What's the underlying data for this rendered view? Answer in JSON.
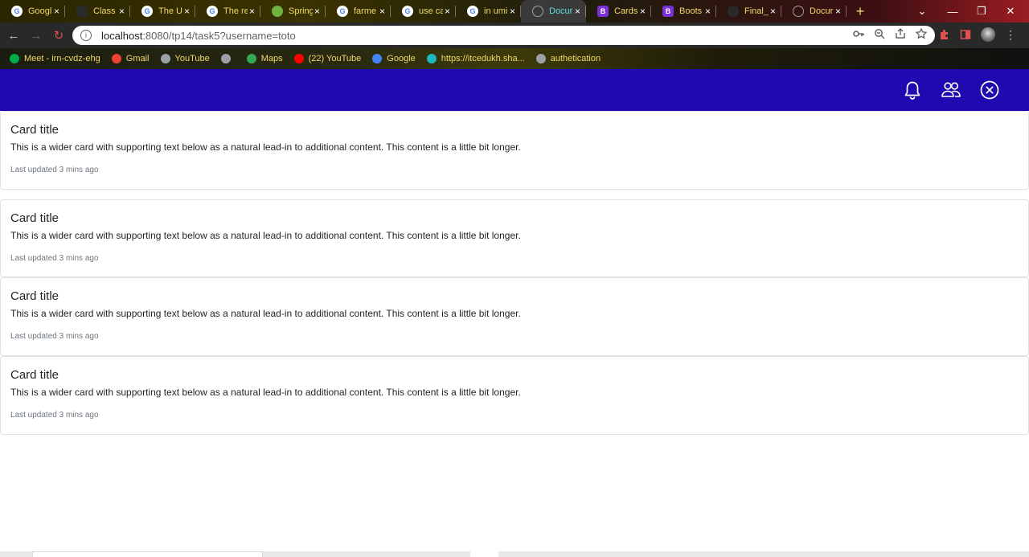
{
  "browser": {
    "tabs": [
      {
        "title": "Googl",
        "icon": "google-icon"
      },
      {
        "title": "Class",
        "icon": "classroom-icon"
      },
      {
        "title": "The U",
        "icon": "google-icon"
      },
      {
        "title": "The re",
        "icon": "google-icon"
      },
      {
        "title": "Spring",
        "icon": "spring-icon"
      },
      {
        "title": "farme",
        "icon": "google-icon"
      },
      {
        "title": "use ca",
        "icon": "google-icon"
      },
      {
        "title": "in umi",
        "icon": "google-icon"
      },
      {
        "title": "Docur",
        "icon": "globe-icon",
        "active": true
      },
      {
        "title": "Cards",
        "icon": "bootstrap-icon"
      },
      {
        "title": "Boots",
        "icon": "bootstrap-icon"
      },
      {
        "title": "Final_",
        "icon": "github-icon"
      },
      {
        "title": "Docur",
        "icon": "globe-icon"
      }
    ],
    "tab_close": "×",
    "new_tab": "+",
    "window_controls": {
      "chevron": "⌄",
      "minimize": "—",
      "maximize": "❐",
      "close": "✕"
    },
    "nav": {
      "back": "←",
      "forward": "→",
      "reload": "↻"
    },
    "url": {
      "host": "localhost",
      "path": ":8080/tp14/task5?username=toto"
    },
    "bookmarks": [
      {
        "label": "Meet - irn-cvdz-ehg",
        "color": "#00ac47"
      },
      {
        "label": "Gmail",
        "color": "#ea4335"
      },
      {
        "label": "YouTube",
        "color": "#9aa0a6"
      },
      {
        "label": "",
        "color": "#9aa0a6"
      },
      {
        "label": "Maps",
        "color": "#34a853"
      },
      {
        "label": "(22) YouTube",
        "color": "#ff0000"
      },
      {
        "label": "Google",
        "color": "#4285f4"
      },
      {
        "label": "https://itcedukh.sha...",
        "color": "#1fb6c1"
      },
      {
        "label": "authetication",
        "color": "#9aa0a6"
      }
    ],
    "colors": {
      "accent_tab_text": "#f1d96a",
      "active_tab_text": "#5ee0e0"
    }
  },
  "navbar": {
    "background": "#2009b0",
    "icons": [
      "bell-icon",
      "people-icon",
      "close-circle-icon"
    ]
  },
  "cards": [
    {
      "title": "Card title",
      "text": "This is a wider card with supporting text below as a natural lead-in to additional content. This content is a little bit longer.",
      "meta": "Last updated 3 mins ago"
    },
    {
      "title": "Card title",
      "text": "This is a wider card with supporting text below as a natural lead-in to additional content. This content is a little bit longer.",
      "meta": "Last updated 3 mins ago"
    },
    {
      "title": "Card title",
      "text": "This is a wider card with supporting text below as a natural lead-in to additional content. This content is a little bit longer.",
      "meta": "Last updated 3 mins ago"
    },
    {
      "title": "Card title",
      "text": "This is a wider card with supporting text below as a natural lead-in to additional content. This content is a little bit longer.",
      "meta": "Last updated 3 mins ago"
    }
  ]
}
